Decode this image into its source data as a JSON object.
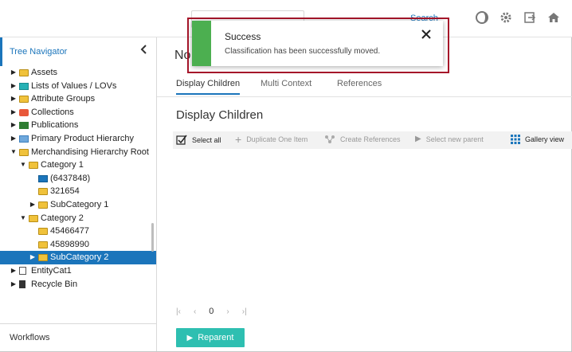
{
  "sidebar": {
    "title": "Tree Navigator",
    "tree": [
      {
        "label": "Assets",
        "toggle": "▶",
        "icon": "folder"
      },
      {
        "label": "Lists of Values / LOVs",
        "toggle": "▶",
        "icon": "folder-teal"
      },
      {
        "label": "Attribute Groups",
        "toggle": "▶",
        "icon": "folder"
      },
      {
        "label": "Collections",
        "toggle": "▶",
        "icon": "collections-icon"
      },
      {
        "label": "Publications",
        "toggle": "▶",
        "icon": "publications-icon"
      },
      {
        "label": "Primary Product Hierarchy",
        "toggle": "▶",
        "icon": "folder-lblue"
      },
      {
        "label": "Merchandising Hierarchy Root",
        "toggle": "▼",
        "icon": "folder"
      },
      {
        "label": "Category 1",
        "toggle": "▼",
        "icon": "folder"
      },
      {
        "label": "(6437848)",
        "toggle": "",
        "icon": "folder-blue"
      },
      {
        "label": "321654",
        "toggle": "",
        "icon": "folder"
      },
      {
        "label": "SubCategory 1",
        "toggle": "▶",
        "icon": "folder"
      },
      {
        "label": "Category 2",
        "toggle": "▼",
        "icon": "folder"
      },
      {
        "label": "45466477",
        "toggle": "",
        "icon": "folder"
      },
      {
        "label": "45898990",
        "toggle": "",
        "icon": "folder"
      },
      {
        "label": "SubCategory 2",
        "toggle": "▶",
        "icon": "folder",
        "selected": true
      },
      {
        "label": "EntityCat1",
        "toggle": "▶",
        "icon": "entity-icon"
      },
      {
        "label": "Recycle Bin",
        "toggle": "▶",
        "icon": "trash-icon"
      }
    ],
    "workflows_label": "Workflows"
  },
  "header": {
    "partial_search_text": "Search"
  },
  "main": {
    "page_title": "No",
    "tabs": [
      {
        "label": "Display Children"
      },
      {
        "label": "Multi Context"
      },
      {
        "label": "References"
      }
    ],
    "section_title": "Display Children",
    "toolbar": {
      "select_all": "Select all",
      "duplicate": "Duplicate One Item",
      "create_references": "Create References",
      "select_new_parent": "Select new parent",
      "gallery_view": "Gallery view"
    },
    "pager": {
      "page": "0"
    },
    "reparent_label": "Reparent"
  },
  "toast": {
    "title": "Success",
    "message": "Classification has been successfully moved."
  },
  "colors": {
    "accent": "#1b75bb",
    "success": "#4caf50",
    "highlight_border": "#a6162a",
    "reparent_button": "#2ebfb1"
  }
}
